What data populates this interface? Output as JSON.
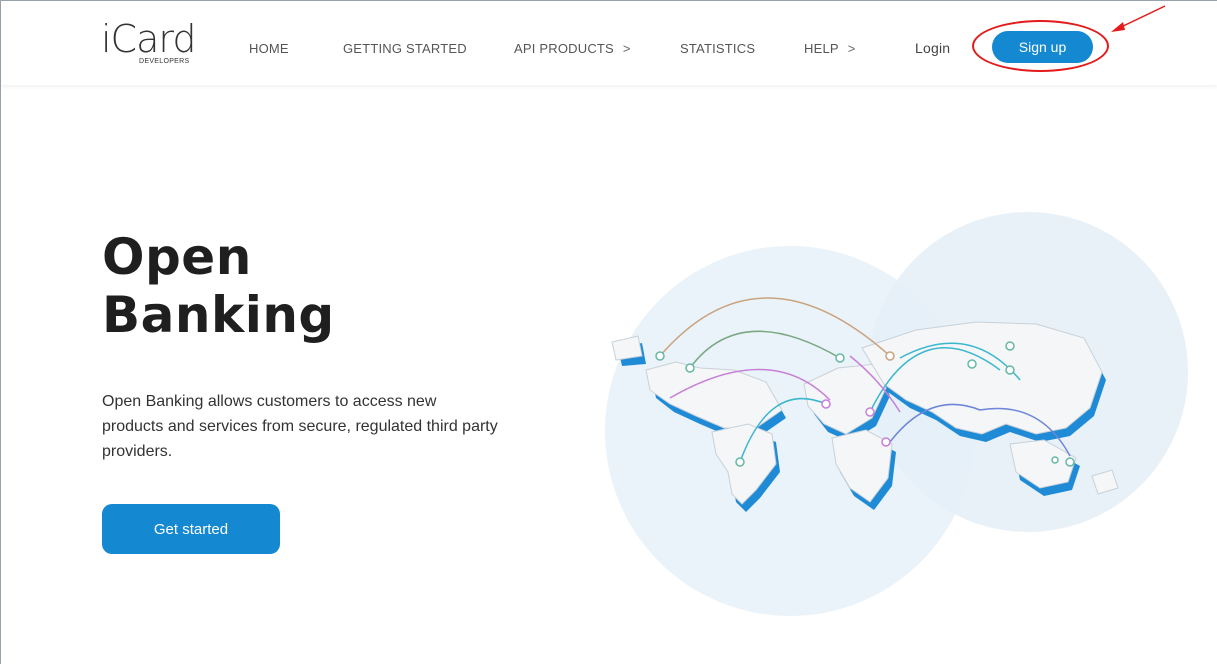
{
  "header": {
    "logo": {
      "main": "iCard",
      "sub": "DEVELOPERS"
    },
    "nav": [
      {
        "label": "HOME",
        "has_chevron": false
      },
      {
        "label": "GETTING STARTED",
        "has_chevron": false
      },
      {
        "label": "API PRODUCTS",
        "has_chevron": true
      },
      {
        "label": "STATISTICS",
        "has_chevron": false
      },
      {
        "label": "HELP",
        "has_chevron": true
      }
    ],
    "chevron": ">",
    "login_label": "Login",
    "signup_label": "Sign up"
  },
  "hero": {
    "title_line1": "Open",
    "title_line2": "Banking",
    "description": "Open Banking allows customers to access new products and services from secure, regulated third party providers.",
    "cta_label": "Get started"
  },
  "colors": {
    "accent": "#1488d1",
    "annotation": "#e31b1b",
    "map_circle": "#eaf3f9",
    "map_land": "#f4f6f8",
    "map_shadow": "#1f8bd6"
  },
  "icons": {
    "annotation": "red-ellipse-with-arrow",
    "illustration": "world-map-illustration"
  }
}
